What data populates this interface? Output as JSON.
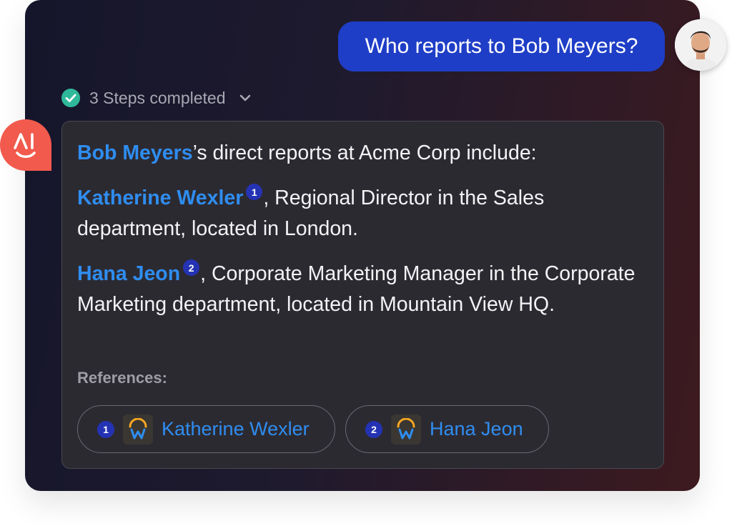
{
  "user_message": "Who reports to Bob Meyers?",
  "steps": {
    "label": "3 Steps completed"
  },
  "assistant_logo_text": "AI",
  "answer": {
    "intro_name": "Bob Meyers",
    "intro_rest": "’s direct reports at Acme Corp include:",
    "items": [
      {
        "name": "Katherine Wexler",
        "citation": "1",
        "text": ", Regional Director in the Sales department, located in London."
      },
      {
        "name": "Hana Jeon",
        "citation": "2",
        "text": ", Corporate Marketing Manager in the Corporate Marketing department, located in Mountain View HQ."
      }
    ]
  },
  "references": {
    "label": "References:",
    "items": [
      {
        "number": "1",
        "name": "Katherine Wexler",
        "icon": "workday-icon"
      },
      {
        "number": "2",
        "name": "Hana Jeon",
        "icon": "workday-icon"
      }
    ]
  },
  "colors": {
    "accent_link": "#2f8df0",
    "user_bubble": "#1f3ec7",
    "citation_badge": "#2433b3",
    "ai_logo": "#f15a4c",
    "check": "#2fb99a"
  }
}
